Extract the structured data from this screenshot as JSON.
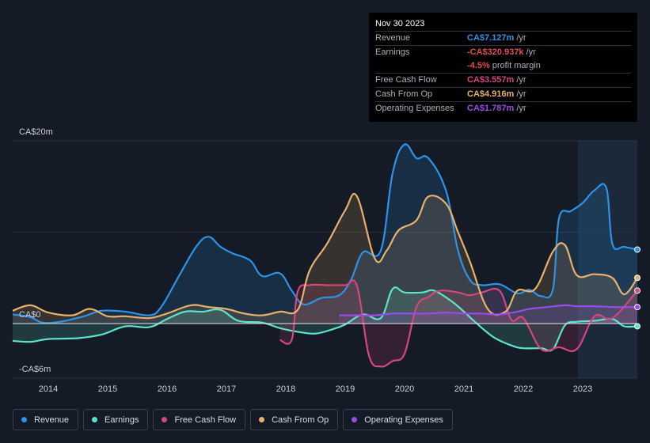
{
  "tooltip": {
    "date": "Nov 30 2023",
    "rows": [
      {
        "label": "Revenue",
        "value": "CA$7.127m",
        "unit": "/yr",
        "color": "#2e93e8"
      },
      {
        "label": "Earnings",
        "value": "-CA$320.937k",
        "unit": "/yr",
        "color": "#e24b4b"
      },
      {
        "label": "",
        "value": "-4.5%",
        "unit": "profit margin",
        "color": "#e24b4b"
      },
      {
        "label": "Free Cash Flow",
        "value": "CA$3.557m",
        "unit": "/yr",
        "color": "#d6457e"
      },
      {
        "label": "Cash From Op",
        "value": "CA$4.916m",
        "unit": "/yr",
        "color": "#e8b06a"
      },
      {
        "label": "Operating Expenses",
        "value": "CA$1.787m",
        "unit": "/yr",
        "color": "#9b4be6"
      }
    ]
  },
  "legend": [
    {
      "label": "Revenue",
      "color": "#2e93e8"
    },
    {
      "label": "Earnings",
      "color": "#5de3c8"
    },
    {
      "label": "Free Cash Flow",
      "color": "#d6457e"
    },
    {
      "label": "Cash From Op",
      "color": "#e8b06a"
    },
    {
      "label": "Operating Expenses",
      "color": "#9b4be6"
    }
  ],
  "chart_data": {
    "type": "area",
    "y_tick_labels": [
      "CA$20m",
      "CA$0",
      "-CA$6m"
    ],
    "ylim": [
      -6,
      20
    ],
    "xlim": [
      2013.4,
      2023.92
    ],
    "x_tick_labels": [
      "2014",
      "2015",
      "2016",
      "2017",
      "2018",
      "2019",
      "2020",
      "2021",
      "2022",
      "2023"
    ],
    "x_ticks": [
      2014,
      2015,
      2016,
      2017,
      2018,
      2019,
      2020,
      2021,
      2022,
      2023
    ],
    "forecast_shade_start": 2022.92,
    "grid": true,
    "series": [
      {
        "name": "Revenue",
        "color": "#2e93e8",
        "x": [
          2013.4,
          2013.7,
          2013.9,
          2014.2,
          2014.6,
          2014.9,
          2015.3,
          2015.7,
          2015.9,
          2016.2,
          2016.5,
          2016.7,
          2016.9,
          2017.1,
          2017.4,
          2017.6,
          2017.9,
          2018.1,
          2018.3,
          2018.6,
          2018.9,
          2019.1,
          2019.3,
          2019.6,
          2019.8,
          2020.0,
          2020.2,
          2020.4,
          2020.7,
          2020.9,
          2021.1,
          2021.3,
          2021.6,
          2021.9,
          2022.1,
          2022.3,
          2022.5,
          2022.6,
          2022.8,
          2023.0,
          2023.2,
          2023.4,
          2023.5,
          2023.7,
          2023.92
        ],
        "values": [
          1.0,
          0.7,
          0.1,
          0.2,
          0.8,
          1.4,
          1.3,
          0.9,
          1.8,
          5.2,
          8.5,
          9.5,
          8.4,
          7.7,
          6.9,
          5.2,
          5.5,
          3.6,
          2.1,
          2.8,
          3.1,
          4.8,
          7.8,
          8.0,
          16.5,
          19.6,
          18.1,
          18.1,
          14.5,
          8.0,
          4.8,
          4.2,
          4.3,
          3.3,
          3.7,
          3.0,
          3.8,
          11.5,
          12.3,
          13.2,
          14.6,
          14.8,
          8.7,
          8.4,
          8.1
        ]
      },
      {
        "name": "Earnings",
        "color": "#5de3c8",
        "x": [
          2013.4,
          2013.7,
          2014.0,
          2014.5,
          2014.9,
          2015.3,
          2015.7,
          2016.0,
          2016.3,
          2016.6,
          2016.9,
          2017.2,
          2017.6,
          2017.9,
          2018.2,
          2018.5,
          2018.8,
          2019.0,
          2019.3,
          2019.6,
          2019.8,
          2020.0,
          2020.3,
          2020.5,
          2020.8,
          2021.0,
          2021.2,
          2021.5,
          2021.8,
          2022.0,
          2022.3,
          2022.5,
          2022.7,
          2022.9,
          2023.2,
          2023.5,
          2023.7,
          2023.92
        ],
        "values": [
          -1.9,
          -2.0,
          -1.7,
          -1.6,
          -1.2,
          -0.3,
          -0.4,
          0.5,
          1.3,
          1.3,
          1.5,
          0.3,
          0.1,
          -0.5,
          -0.9,
          -1.1,
          -0.6,
          -0.1,
          1.0,
          0.6,
          3.8,
          3.4,
          3.4,
          3.6,
          2.4,
          1.3,
          0.1,
          -1.5,
          -2.4,
          -2.7,
          -2.7,
          -2.8,
          -0.2,
          0.2,
          0.3,
          0.5,
          -0.3,
          -0.3
        ]
      },
      {
        "name": "Free Cash Flow",
        "color": "#d6457e",
        "x": [
          2017.9,
          2018.1,
          2018.2,
          2018.4,
          2018.7,
          2019.0,
          2019.2,
          2019.4,
          2019.6,
          2019.8,
          2020.0,
          2020.2,
          2020.4,
          2020.6,
          2020.9,
          2021.1,
          2021.3,
          2021.6,
          2021.8,
          2022.0,
          2022.3,
          2022.6,
          2022.9,
          2023.2,
          2023.5,
          2023.92
        ],
        "values": [
          -1.8,
          -1.8,
          3.5,
          4.2,
          4.2,
          4.2,
          4.1,
          -3.5,
          -4.7,
          -4.1,
          -3.3,
          1.8,
          2.9,
          3.6,
          3.4,
          3.1,
          3.4,
          3.6,
          0.4,
          0.6,
          -2.8,
          -2.6,
          -2.8,
          0.8,
          0.6,
          3.6
        ]
      },
      {
        "name": "Cash From Op",
        "color": "#e8b06a",
        "x": [
          2013.4,
          2013.7,
          2014.0,
          2014.4,
          2014.7,
          2015.0,
          2015.3,
          2015.7,
          2016.0,
          2016.4,
          2016.7,
          2017.0,
          2017.3,
          2017.6,
          2017.9,
          2018.2,
          2018.4,
          2018.7,
          2019.0,
          2019.2,
          2019.5,
          2019.7,
          2019.9,
          2020.2,
          2020.4,
          2020.7,
          2020.9,
          2021.1,
          2021.4,
          2021.7,
          2021.9,
          2022.2,
          2022.5,
          2022.7,
          2022.9,
          2023.2,
          2023.5,
          2023.7,
          2023.92
        ],
        "values": [
          1.4,
          2.0,
          1.2,
          0.9,
          1.6,
          0.8,
          0.8,
          0.6,
          1.1,
          2.0,
          1.8,
          1.6,
          1.1,
          0.9,
          1.3,
          1.5,
          5.8,
          8.8,
          12.4,
          13.9,
          7.1,
          8.0,
          10.2,
          11.3,
          13.9,
          13.1,
          10.0,
          6.8,
          1.6,
          1.3,
          3.6,
          3.8,
          7.9,
          8.6,
          5.3,
          5.4,
          5.0,
          3.2,
          5.0
        ]
      },
      {
        "name": "Operating Expenses",
        "color": "#9b4be6",
        "x": [
          2018.9,
          2019.2,
          2019.5,
          2019.8,
          2020.1,
          2020.4,
          2020.7,
          2021.0,
          2021.3,
          2021.6,
          2021.9,
          2022.1,
          2022.4,
          2022.7,
          2022.9,
          2023.2,
          2023.5,
          2023.7,
          2023.92
        ],
        "values": [
          0.9,
          0.9,
          0.9,
          1.1,
          1.1,
          1.1,
          1.2,
          1.1,
          1.1,
          1.0,
          1.3,
          1.6,
          1.8,
          2.0,
          1.9,
          1.9,
          1.8,
          1.8,
          1.8
        ]
      }
    ]
  }
}
